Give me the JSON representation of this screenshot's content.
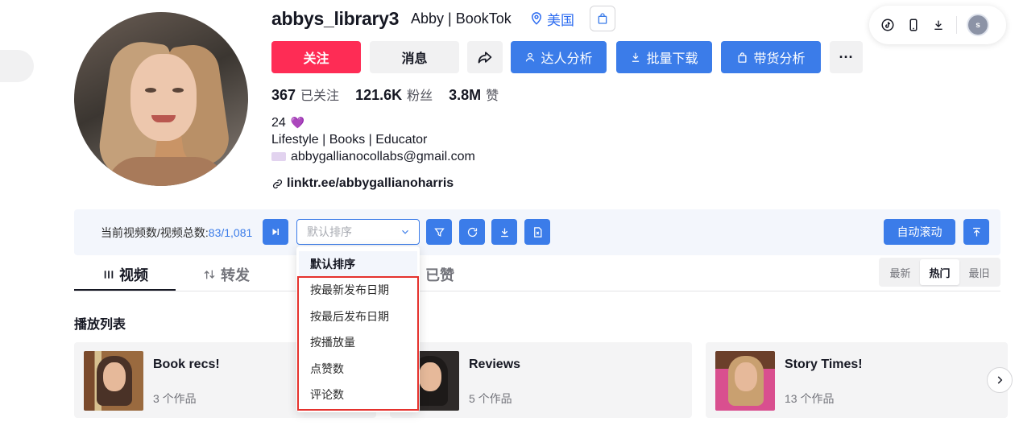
{
  "profile": {
    "username": "abbys_library3",
    "nickname": "Abby | BookTok",
    "region": "美国",
    "stats": [
      {
        "value": "367",
        "label": "已关注"
      },
      {
        "value": "121.6K",
        "label": "粉丝"
      },
      {
        "value": "3.8M",
        "label": "赞"
      }
    ],
    "bio_age": "24",
    "bio_line": "Lifestyle | Books | Educator",
    "bio_email": "abbygallianocollabs@gmail.com",
    "link": "linktr.ee/abbygallianoharris"
  },
  "actions": {
    "follow": "关注",
    "message": "消息",
    "creator_analysis": "达人分析",
    "bulk_download": "批量下载",
    "commerce_analysis": "带货分析",
    "more": "···"
  },
  "topbar": {
    "avatar_letter": "s"
  },
  "toolbar": {
    "count_label": "当前视频数/视频总数:",
    "count_value": "83/1,081",
    "sort_placeholder": "默认排序",
    "auto_scroll": "自动滚动"
  },
  "tabs": [
    {
      "label": "视频",
      "active": true
    },
    {
      "label": "转发",
      "active": false
    },
    {
      "label": "已赞",
      "active": false
    }
  ],
  "sort_segment": [
    "最新",
    "热门",
    "最旧"
  ],
  "sort_segment_active": "热门",
  "playlists": {
    "title": "播放列表",
    "items": [
      {
        "name": "Book recs!",
        "count": "3 个作品"
      },
      {
        "name": "Reviews",
        "count": "5 个作品"
      },
      {
        "name": "Story Times!",
        "count": "13 个作品"
      }
    ]
  },
  "dropdown": {
    "options": [
      "默认排序",
      "按最新发布日期",
      "按最后发布日期",
      "按播放量",
      "点赞数",
      "评论数"
    ],
    "selected": "默认排序"
  },
  "colors": {
    "accent_blue": "#3b7ce9",
    "follow_red": "#fe2c55",
    "highlight_red": "#e5322d"
  }
}
